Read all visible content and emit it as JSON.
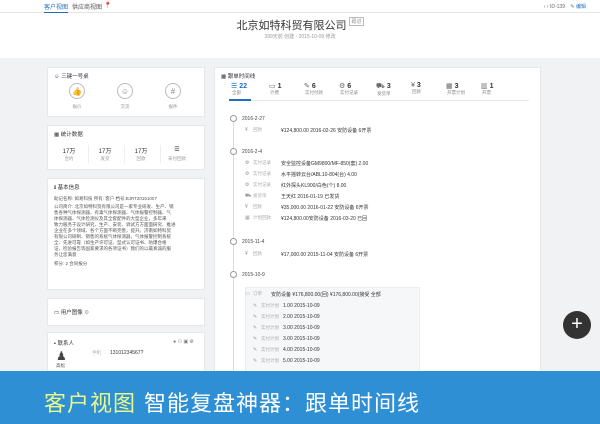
{
  "tabs": [
    {
      "label": "客户视图"
    },
    {
      "label": "供应商视图"
    }
  ],
  "topright": {
    "id_text": "ID-139",
    "edit_label": "编辑"
  },
  "company": {
    "name": "北京如特科贸有限公司",
    "tag": "跟进",
    "subline": "399天前 创建 · 2015-10-09 修改"
  },
  "quick": {
    "title": "三键一号桌",
    "items": [
      {
        "icon": "thumb-up",
        "glyph": "👍",
        "label": "报价"
      },
      {
        "icon": "smile",
        "glyph": "☺",
        "label": "交流"
      },
      {
        "icon": "hash",
        "glyph": "#",
        "label": "报件"
      }
    ]
  },
  "stats": {
    "title": "统计数据",
    "items": [
      {
        "value": "17万",
        "label": "合约"
      },
      {
        "value": "17万",
        "label": "发货"
      },
      {
        "value": "17万",
        "label": "回款"
      },
      {
        "value": "☰",
        "label": "未付回款"
      }
    ]
  },
  "info": {
    "title": "基本信息",
    "lines": [
      "助记名称: 如易科技  所有: 客户  档号:BJRT20151007",
      "公司简介: 北京如特科贸有限公司是一家专业研发、生产、销",
      "售各种气体探测器、有毒气体探测器、气体报警控制器、气",
      "体探测器、气体检测仪及其全套配件的大型企业，多年来",
      "致力服务于设计研究、生产、安装、调试方方面面研究、推进",
      "企业在多个领域、各个方面不断完善，提升。济南如特科贸",
      "有限公司研制、销售的系统气体探测器，气体报警控制系统",
      "全、先进可靠（如生产许可证、型式认可证书、防爆合格",
      "证、检验报告等国家要求的各项证书）我们的以最真诚的服",
      "务让您满意",
      "积分: 2 合同报分"
    ]
  },
  "user_images": {
    "title": "用户图像"
  },
  "contacts": {
    "title": "联系人",
    "name": "高松",
    "phone_key": "手机",
    "phone": "13101234567?"
  },
  "timeline_title": "跟单时间线",
  "timeline_tabs": [
    {
      "icon": "list",
      "glyph": "☰",
      "count": "22",
      "label": "全部"
    },
    {
      "icon": "doc",
      "glyph": "▭",
      "count": "1",
      "label": "计费"
    },
    {
      "icon": "wrench",
      "glyph": "✎",
      "count": "6",
      "label": "实付付款"
    },
    {
      "icon": "gear",
      "glyph": "⚙",
      "count": "6",
      "label": "实付记录"
    },
    {
      "icon": "truck",
      "glyph": "⛟",
      "count": "3",
      "label": "发货单"
    },
    {
      "icon": "yen",
      "glyph": "¥",
      "count": "3",
      "label": "回款"
    },
    {
      "icon": "calc",
      "glyph": "▦",
      "count": "3",
      "label": "开票计划"
    },
    {
      "icon": "chart",
      "glyph": "▥",
      "count": "1",
      "label": "开票"
    }
  ],
  "timeline": [
    {
      "date": "2016-2-27",
      "entries": [
        {
          "k": "回款",
          "v": "¥124,800.00 2016-02-26 安防设备  6开票"
        }
      ]
    },
    {
      "date": "2016-2-4",
      "entries": [
        {
          "k": "实付记录",
          "v": "安全监控设备GM9800/MF-850(套) 2.00"
        },
        {
          "k": "实付记录",
          "v": "水平摇转云台/ABL10-804(台) 4.00"
        },
        {
          "k": "实付记录",
          "v": "红外探头KL900/白色(个) 8.00"
        },
        {
          "k": "发货单",
          "v": "王天红 2016-01-19 已发货"
        },
        {
          "k": "回款",
          "v": "¥35,000.00 2016-01-22 安防设备  6开票"
        },
        {
          "k": "计划回款",
          "v": "¥124,800.00安防设备 2016-03-20 已回"
        }
      ]
    },
    {
      "date": "2015-11-4",
      "entries": [
        {
          "k": "回款",
          "v": "¥17,000.00 2015-11-04 安防设备  6开票"
        }
      ]
    },
    {
      "date": "2015-10-9",
      "entries": [
        {
          "k": "订单",
          "v": "安防设备 ¥176,800.00(回) ¥176,800.00(接受 全部"
        }
      ]
    }
  ],
  "sub_entries": [
    {
      "k": "实付计划",
      "v": "1.00 2015-10-09"
    },
    {
      "k": "实付计划",
      "v": "2.00 2015-10-09"
    },
    {
      "k": "实付计划",
      "v": "3.00 2015-10-09"
    },
    {
      "k": "实付计划",
      "v": "3.00 2015-10-09"
    },
    {
      "k": "实付计划",
      "v": "4.00 2015-10-09"
    },
    {
      "k": "实付计划",
      "v": "5.00 2015-10-09"
    }
  ],
  "banner": {
    "part1": "客户视图",
    "part2": "智能复盘神器：跟单时间线"
  },
  "fab": {
    "glyph": "+"
  }
}
